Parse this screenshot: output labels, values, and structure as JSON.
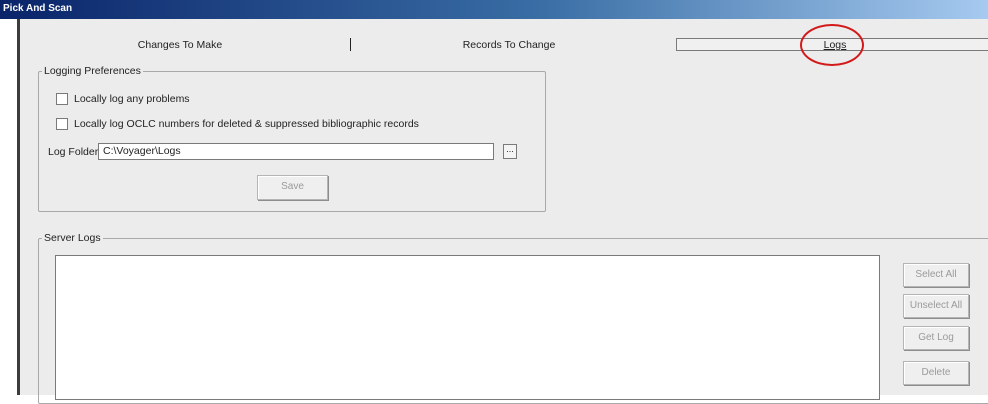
{
  "window": {
    "title": "Pick And Scan"
  },
  "tabs": [
    {
      "label": "Changes To Make"
    },
    {
      "label": "Records To Change"
    },
    {
      "label": "Logs"
    }
  ],
  "logging_preferences": {
    "legend": "Logging Preferences",
    "log_problems_label": "Locally log any problems",
    "log_oclc_label": "Locally log OCLC numbers for deleted & suppressed bibliographic records",
    "log_folder_label": "Log Folder:",
    "log_folder_value": "C:\\Voyager\\Logs",
    "browse_label": "...",
    "save_label": "Save"
  },
  "server_logs": {
    "legend": "Server Logs",
    "select_all_label": "Select All",
    "unselect_all_label": "Unselect All",
    "get_log_label": "Get Log",
    "delete_label": "Delete"
  },
  "colors": {
    "callout": "#d31a1a"
  }
}
